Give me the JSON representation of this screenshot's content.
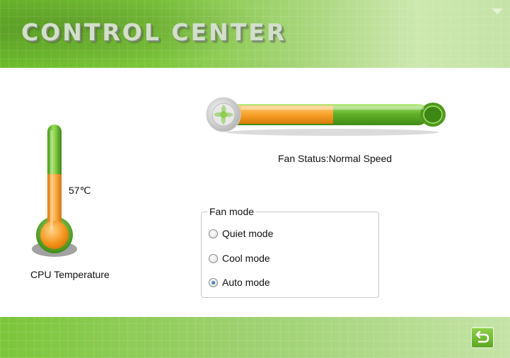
{
  "header": {
    "title": "CONTROL CENTER",
    "menu_icon": "dropdown-triangle-icon"
  },
  "temperature": {
    "value_label": "57℃",
    "fill_fraction": 0.57,
    "label": "CPU Temperature"
  },
  "fan": {
    "status_text": "Fan Status:Normal Speed",
    "fill_fraction": 0.46
  },
  "fan_mode": {
    "legend": "Fan mode",
    "options": [
      {
        "label": "Quiet mode",
        "checked": false
      },
      {
        "label": "Cool mode",
        "checked": false
      },
      {
        "label": "Auto mode",
        "checked": true
      }
    ]
  },
  "footer": {
    "back_icon": "return-arrow-icon"
  },
  "colors": {
    "green": "#6cbc2c",
    "orange": "#f7a12a",
    "light_green": "#c4e3a6"
  }
}
